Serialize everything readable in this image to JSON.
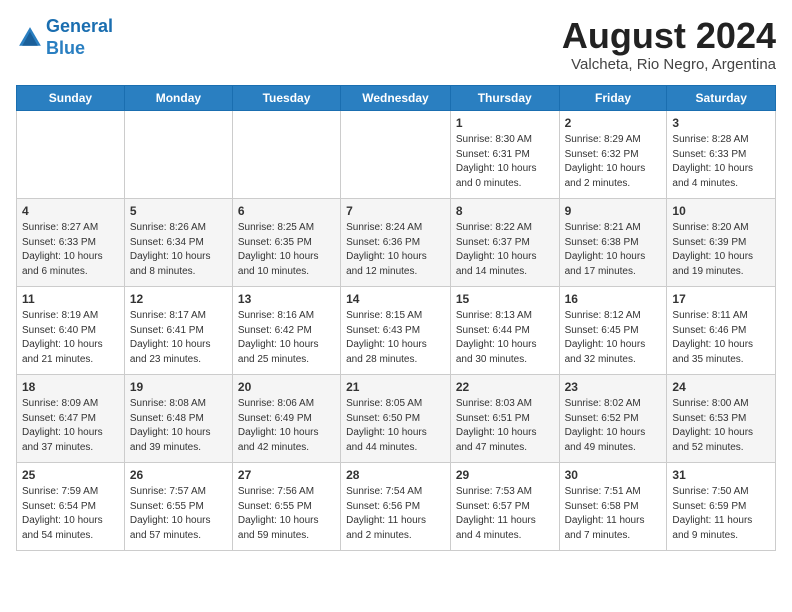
{
  "header": {
    "logo_line1": "General",
    "logo_line2": "Blue",
    "month": "August 2024",
    "location": "Valcheta, Rio Negro, Argentina"
  },
  "weekdays": [
    "Sunday",
    "Monday",
    "Tuesday",
    "Wednesday",
    "Thursday",
    "Friday",
    "Saturday"
  ],
  "weeks": [
    [
      {
        "day": "",
        "info": ""
      },
      {
        "day": "",
        "info": ""
      },
      {
        "day": "",
        "info": ""
      },
      {
        "day": "",
        "info": ""
      },
      {
        "day": "1",
        "info": "Sunrise: 8:30 AM\nSunset: 6:31 PM\nDaylight: 10 hours\nand 0 minutes."
      },
      {
        "day": "2",
        "info": "Sunrise: 8:29 AM\nSunset: 6:32 PM\nDaylight: 10 hours\nand 2 minutes."
      },
      {
        "day": "3",
        "info": "Sunrise: 8:28 AM\nSunset: 6:33 PM\nDaylight: 10 hours\nand 4 minutes."
      }
    ],
    [
      {
        "day": "4",
        "info": "Sunrise: 8:27 AM\nSunset: 6:33 PM\nDaylight: 10 hours\nand 6 minutes."
      },
      {
        "day": "5",
        "info": "Sunrise: 8:26 AM\nSunset: 6:34 PM\nDaylight: 10 hours\nand 8 minutes."
      },
      {
        "day": "6",
        "info": "Sunrise: 8:25 AM\nSunset: 6:35 PM\nDaylight: 10 hours\nand 10 minutes."
      },
      {
        "day": "7",
        "info": "Sunrise: 8:24 AM\nSunset: 6:36 PM\nDaylight: 10 hours\nand 12 minutes."
      },
      {
        "day": "8",
        "info": "Sunrise: 8:22 AM\nSunset: 6:37 PM\nDaylight: 10 hours\nand 14 minutes."
      },
      {
        "day": "9",
        "info": "Sunrise: 8:21 AM\nSunset: 6:38 PM\nDaylight: 10 hours\nand 17 minutes."
      },
      {
        "day": "10",
        "info": "Sunrise: 8:20 AM\nSunset: 6:39 PM\nDaylight: 10 hours\nand 19 minutes."
      }
    ],
    [
      {
        "day": "11",
        "info": "Sunrise: 8:19 AM\nSunset: 6:40 PM\nDaylight: 10 hours\nand 21 minutes."
      },
      {
        "day": "12",
        "info": "Sunrise: 8:17 AM\nSunset: 6:41 PM\nDaylight: 10 hours\nand 23 minutes."
      },
      {
        "day": "13",
        "info": "Sunrise: 8:16 AM\nSunset: 6:42 PM\nDaylight: 10 hours\nand 25 minutes."
      },
      {
        "day": "14",
        "info": "Sunrise: 8:15 AM\nSunset: 6:43 PM\nDaylight: 10 hours\nand 28 minutes."
      },
      {
        "day": "15",
        "info": "Sunrise: 8:13 AM\nSunset: 6:44 PM\nDaylight: 10 hours\nand 30 minutes."
      },
      {
        "day": "16",
        "info": "Sunrise: 8:12 AM\nSunset: 6:45 PM\nDaylight: 10 hours\nand 32 minutes."
      },
      {
        "day": "17",
        "info": "Sunrise: 8:11 AM\nSunset: 6:46 PM\nDaylight: 10 hours\nand 35 minutes."
      }
    ],
    [
      {
        "day": "18",
        "info": "Sunrise: 8:09 AM\nSunset: 6:47 PM\nDaylight: 10 hours\nand 37 minutes."
      },
      {
        "day": "19",
        "info": "Sunrise: 8:08 AM\nSunset: 6:48 PM\nDaylight: 10 hours\nand 39 minutes."
      },
      {
        "day": "20",
        "info": "Sunrise: 8:06 AM\nSunset: 6:49 PM\nDaylight: 10 hours\nand 42 minutes."
      },
      {
        "day": "21",
        "info": "Sunrise: 8:05 AM\nSunset: 6:50 PM\nDaylight: 10 hours\nand 44 minutes."
      },
      {
        "day": "22",
        "info": "Sunrise: 8:03 AM\nSunset: 6:51 PM\nDaylight: 10 hours\nand 47 minutes."
      },
      {
        "day": "23",
        "info": "Sunrise: 8:02 AM\nSunset: 6:52 PM\nDaylight: 10 hours\nand 49 minutes."
      },
      {
        "day": "24",
        "info": "Sunrise: 8:00 AM\nSunset: 6:53 PM\nDaylight: 10 hours\nand 52 minutes."
      }
    ],
    [
      {
        "day": "25",
        "info": "Sunrise: 7:59 AM\nSunset: 6:54 PM\nDaylight: 10 hours\nand 54 minutes."
      },
      {
        "day": "26",
        "info": "Sunrise: 7:57 AM\nSunset: 6:55 PM\nDaylight: 10 hours\nand 57 minutes."
      },
      {
        "day": "27",
        "info": "Sunrise: 7:56 AM\nSunset: 6:55 PM\nDaylight: 10 hours\nand 59 minutes."
      },
      {
        "day": "28",
        "info": "Sunrise: 7:54 AM\nSunset: 6:56 PM\nDaylight: 11 hours\nand 2 minutes."
      },
      {
        "day": "29",
        "info": "Sunrise: 7:53 AM\nSunset: 6:57 PM\nDaylight: 11 hours\nand 4 minutes."
      },
      {
        "day": "30",
        "info": "Sunrise: 7:51 AM\nSunset: 6:58 PM\nDaylight: 11 hours\nand 7 minutes."
      },
      {
        "day": "31",
        "info": "Sunrise: 7:50 AM\nSunset: 6:59 PM\nDaylight: 11 hours\nand 9 minutes."
      }
    ]
  ]
}
